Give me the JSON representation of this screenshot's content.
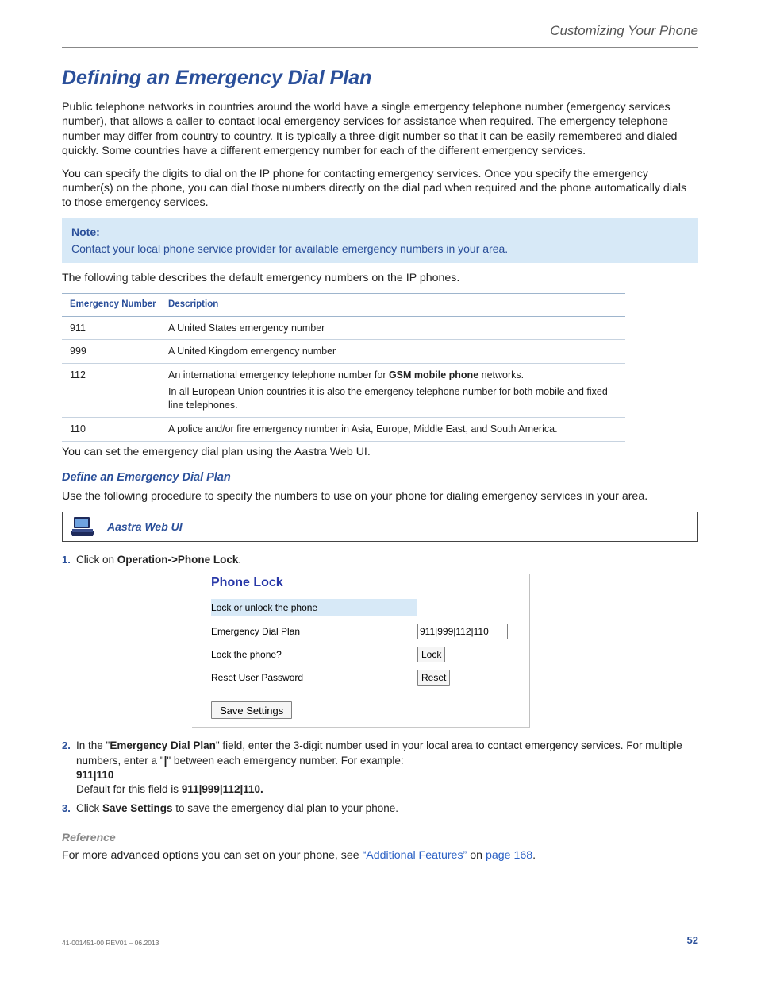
{
  "running_head": "Customizing Your Phone",
  "h1": "Defining an Emergency Dial Plan",
  "intro1": "Public telephone networks in countries around the world have a single emergency telephone number (emergency services number), that allows a caller to contact local emergency services for assistance when required. The emergency telephone number may differ from country to country. It is typically a three-digit number so that it can be easily remembered and dialed quickly. Some countries have a different emergency number for each of the different emergency services.",
  "intro2": "You can specify the digits to dial on the IP phone for contacting emergency services. Once you specify the emergency number(s) on the phone, you can dial those numbers directly on the dial pad when required and the phone automatically dials to those emergency services.",
  "note": {
    "label": "Note:",
    "text": "Contact your local phone service provider for available emergency numbers in your area."
  },
  "table_intro": "The following table describes the default emergency numbers on the IP phones.",
  "table": {
    "headers": {
      "number": "Emergency Number",
      "description": "Description"
    },
    "rows": [
      {
        "number": "911",
        "desc_pre": "A United States emergency number",
        "bold": "",
        "desc_post": "",
        "sub": ""
      },
      {
        "number": "999",
        "desc_pre": "A United Kingdom emergency number",
        "bold": "",
        "desc_post": "",
        "sub": ""
      },
      {
        "number": "112",
        "desc_pre": "An international emergency telephone number for ",
        "bold": "GSM mobile phone",
        "desc_post": " networks.",
        "sub": "In all European Union countries it is also the emergency telephone number for both mobile and fixed-line telephones."
      },
      {
        "number": "110",
        "desc_pre": "A police and/or fire emergency number in Asia, Europe, Middle East, and South America.",
        "bold": "",
        "desc_post": "",
        "sub": ""
      }
    ]
  },
  "after_table": "You can set the emergency dial plan using the Aastra Web UI.",
  "subhead": "Define an Emergency Dial Plan",
  "subhead_intro": "Use the following procedure to specify the numbers to use on your phone for dialing emergency services in your area.",
  "webui_label": "Aastra Web UI",
  "steps": {
    "s1": {
      "pre": "Click on ",
      "bold": "Operation->Phone Lock",
      "post": "."
    },
    "s2": {
      "line1_pre": "In the \"",
      "line1_bold": "Emergency Dial Plan",
      "line1_post": "\" field, enter the 3-digit number used in your local area to contact emergency services. For multiple numbers, enter a \"",
      "line1_pipe": "|",
      "line1_end": "\" between each emergency number. For example:",
      "example": "911|110",
      "default_pre": "Default for this field is ",
      "default_bold": "911|999|112|110."
    },
    "s3": {
      "pre": "Click ",
      "bold": "Save Settings",
      "post": " to save the emergency dial plan to your phone."
    }
  },
  "screenshot": {
    "title": "Phone Lock",
    "header": "Lock or unlock the phone",
    "rows": {
      "dial_label": "Emergency Dial Plan",
      "dial_value": "911|999|112|110",
      "lock_label": "Lock the phone?",
      "lock_btn": "Lock",
      "reset_label": "Reset User Password",
      "reset_btn": "Reset"
    },
    "save_btn": "Save Settings"
  },
  "reference": {
    "head": "Reference",
    "pre": "For more advanced options you can set on your phone, see ",
    "link1": "“Additional Features”",
    "mid": " on ",
    "link2": "page 168",
    "post": "."
  },
  "footer": {
    "doc_id": "41-001451-00 REV01 – 06.2013",
    "page": "52"
  }
}
